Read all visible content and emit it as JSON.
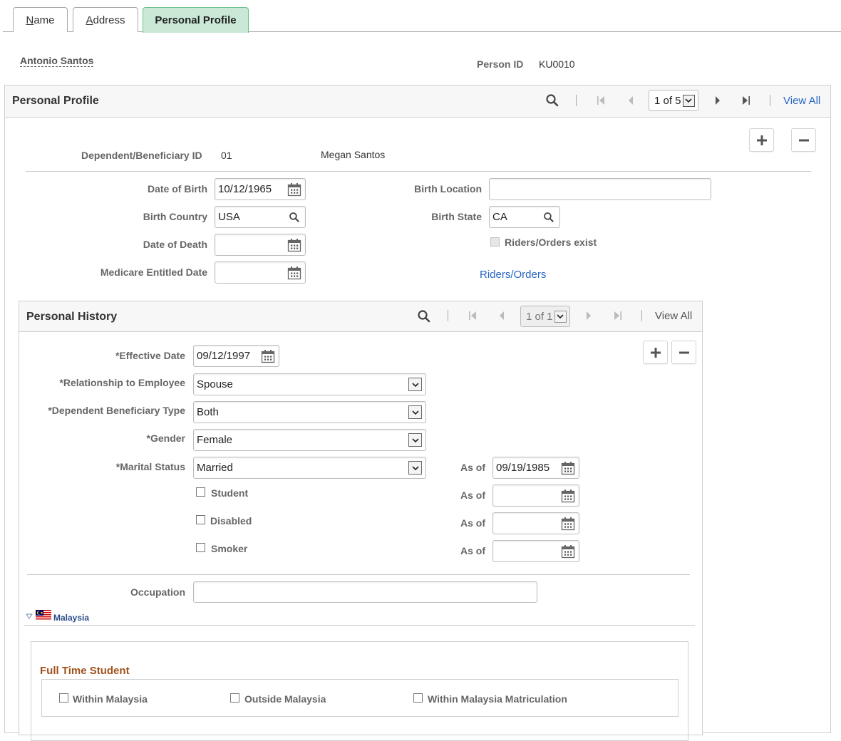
{
  "tabs": [
    {
      "label": "Name",
      "accesskey_char": "N",
      "rest": "ame",
      "active": false
    },
    {
      "label": "Address",
      "accesskey_char": "A",
      "rest": "ddress",
      "active": false
    },
    {
      "label": "Personal Profile",
      "active": true
    }
  ],
  "header": {
    "person_name": "Antonio Santos",
    "person_id_label": "Person ID",
    "person_id": "KU0010"
  },
  "personal_profile": {
    "title": "Personal Profile",
    "pager": {
      "text": "1 of 5",
      "view_all": "View All"
    },
    "dependent_id_label": "Dependent/Beneficiary ID",
    "dependent_id": "01",
    "dependent_name": "Megan Santos",
    "fields": {
      "date_of_birth": {
        "label": "Date of Birth",
        "value": "10/12/1965"
      },
      "birth_country": {
        "label": "Birth Country",
        "value": "USA"
      },
      "date_of_death": {
        "label": "Date of Death",
        "value": ""
      },
      "medicare_entitled_date": {
        "label": "Medicare Entitled Date",
        "value": ""
      },
      "birth_location": {
        "label": "Birth Location",
        "value": ""
      },
      "birth_state": {
        "label": "Birth State",
        "value": "CA"
      },
      "riders_orders_exist": {
        "label": "Riders/Orders exist",
        "checked": false,
        "disabled": true
      }
    },
    "riders_orders_link": "Riders/Orders"
  },
  "personal_history": {
    "title": "Personal History",
    "pager": {
      "text": "1 of 1",
      "view_all": "View All"
    },
    "effective_date": {
      "label": "*Effective Date",
      "value": "09/12/1997"
    },
    "relationship": {
      "label": "*Relationship to Employee",
      "value": "Spouse"
    },
    "dep_ben_type": {
      "label": "*Dependent Beneficiary Type",
      "value": "Both"
    },
    "gender": {
      "label": "*Gender",
      "value": "Female"
    },
    "marital_status": {
      "label": "*Marital Status",
      "value": "Married",
      "as_of_label": "As of",
      "as_of": "09/19/1985"
    },
    "student": {
      "label": "Student",
      "checked": false,
      "as_of_label": "As of",
      "as_of": ""
    },
    "disabled": {
      "label": "Disabled",
      "checked": false,
      "as_of_label": "As of",
      "as_of": ""
    },
    "smoker": {
      "label": "Smoker",
      "checked": false,
      "as_of_label": "As of",
      "as_of": ""
    },
    "occupation": {
      "label": "Occupation",
      "value": ""
    }
  },
  "malaysia": {
    "label": "Malaysia",
    "full_time_student": {
      "title": "Full Time Student",
      "options": [
        {
          "label": "Within Malaysia",
          "checked": false
        },
        {
          "label": "Outside Malaysia",
          "checked": false
        },
        {
          "label": "Within Malaysia Matriculation",
          "checked": false
        }
      ]
    }
  },
  "icons": {
    "search": "search-icon",
    "calendar": "calendar-icon",
    "first": "first-page-icon",
    "prev": "previous-icon",
    "next": "next-icon",
    "last": "last-page-icon",
    "add": "plus-icon",
    "delete": "minus-icon",
    "dropdown": "chevron-down-icon",
    "collapse": "triangle-down-icon",
    "flag": "malaysia-flag-icon"
  },
  "colors": {
    "active_tab_bg": "#c9e9d6",
    "link": "#2a64c5",
    "section_title": "#a0521b",
    "label": "#666666"
  }
}
